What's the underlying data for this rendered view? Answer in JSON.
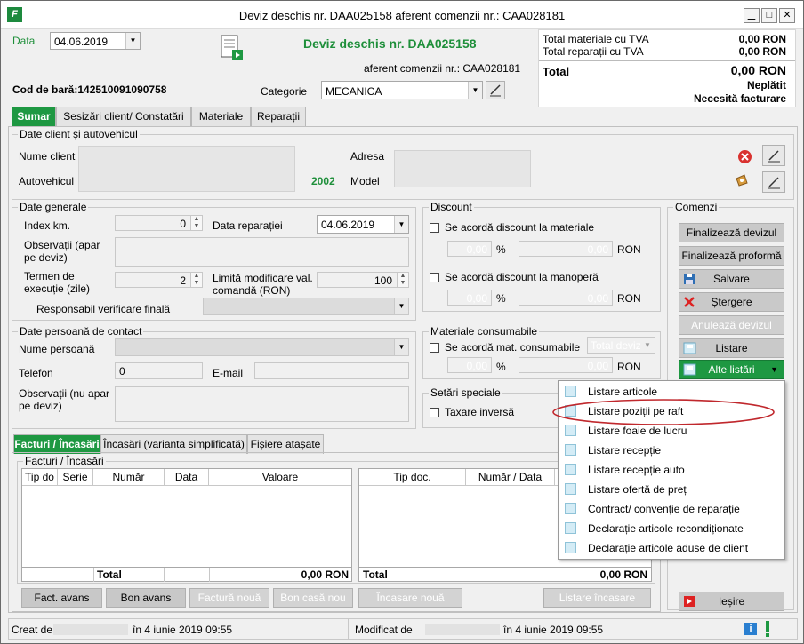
{
  "window": {
    "title": "Deviz deschis nr. DAA025158 aferent comenzii nr.: CAA028181",
    "min_label": "▁",
    "max_label": "□",
    "close_label": "✕"
  },
  "header": {
    "data_label": "Data",
    "data_value": "04.06.2019",
    "doc_title": "Deviz deschis nr. DAA025158",
    "doc_subtitle": "aferent comenzii nr.: CAA028181",
    "barcode_label": "Cod de bară:142510091090758",
    "category_label": "Categorie",
    "category_value": "MECANICA"
  },
  "totals": {
    "materials_label": "Total materiale cu TVA",
    "materials_value": "0,00 RON",
    "repairs_label": "Total reparații cu TVA",
    "repairs_value": "0,00 RON",
    "total_label": "Total",
    "total_value": "0,00 RON",
    "status1": "Neplătit",
    "status2": "Necesită facturare"
  },
  "tabs": [
    {
      "label": "Sumar"
    },
    {
      "label": "Sesizări client/ Constatări"
    },
    {
      "label": "Materiale"
    },
    {
      "label": "Reparații"
    }
  ],
  "client": {
    "group_title": "Date client și autovehicul",
    "name_label": "Nume client",
    "vehicle_label": "Autovehicul",
    "year_value": "2002",
    "address_label": "Adresa",
    "model_label": "Model"
  },
  "general": {
    "group_title": "Date generale",
    "km_label": "Index km.",
    "km_value": "0",
    "repair_date_label": "Data reparației",
    "repair_date_value": "04.06.2019",
    "obs_label": "Observații (apar pe deviz)",
    "term_label": "Termen de execuție (zile)",
    "term_value": "2",
    "limit_label": "Limită modificare val. comandă (RON)",
    "limit_value": "100",
    "responsible_label": "Responsabil verificare finală"
  },
  "contact": {
    "group_title": "Date persoană de contact",
    "name_label": "Nume persoană",
    "phone_label": "Telefon",
    "phone_value": "0",
    "email_label": "E-mail",
    "obs_label": "Observații (nu apar pe deviz)"
  },
  "discount": {
    "group_title": "Discount",
    "materials_check": "Se acordă discount la materiale",
    "labor_check": "Se acordă discount la manoperă",
    "pct_value": "0,00",
    "pct_unit": "%",
    "ron_value": "0,00",
    "ron_unit": "RON"
  },
  "consumables": {
    "group_title": "Materiale consumabile",
    "check_label": "Se acordă mat. consumabile",
    "select_value": "Total deviz",
    "pct_value": "0,00",
    "pct_unit": "%",
    "ron_value": "0,00",
    "ron_unit": "RON"
  },
  "special": {
    "group_title": "Setări speciale",
    "check_label": "Taxare inversă"
  },
  "commands": {
    "group_title": "Comenzi",
    "finalize_deviz": "Finalizează devizul",
    "finalize_proforma": "Finalizează proformă",
    "save": "Salvare",
    "delete": "Ștergere",
    "cancel_deviz": "Anulează devizul",
    "listing": "Listare",
    "other_listings": "Alte listări",
    "exit": "Ieșire"
  },
  "listing_menu": [
    "Listare articole",
    "Listare poziții pe raft",
    "Listare foaie de lucru",
    "Listare recepție",
    "Listare recepție auto",
    "Listare ofertă de preț",
    "Contract/ convenție de reparație",
    "Declarație articole recondiționate",
    "Declarație articole aduse de client"
  ],
  "bottom_tabs": [
    {
      "label": "Facturi / Încasări"
    },
    {
      "label": "Încasări (varianta simplificată)"
    },
    {
      "label": "Fișiere atașate"
    }
  ],
  "invoices": {
    "group_title": "Facturi / Încasări",
    "left_columns": [
      "Tip do",
      "Serie",
      "Număr",
      "Data",
      "Valoare"
    ],
    "left_total_label": "Total",
    "left_total_value": "0,00 RON",
    "right_columns": [
      "Tip doc.",
      "Număr / Data"
    ],
    "right_total_label": "Total",
    "right_total_value": "0,00 RON"
  },
  "bottom_buttons": {
    "advance_invoice": "Fact. avans",
    "advance_voucher": "Bon avans",
    "new_invoice": "Factură nouă",
    "new_receipt": "Bon casă nou",
    "new_payment": "Încasare nouă",
    "payment_listing": "Listare încasare"
  },
  "status": {
    "created_label": "Creat de",
    "created_value": "în 4 iunie 2019 09:55",
    "modified_label": "Modificat de",
    "modified_value": "în 4 iunie 2019 09:55"
  },
  "colors": {
    "accent_green": "#1e9842",
    "highlight_red": "#c0282d"
  }
}
